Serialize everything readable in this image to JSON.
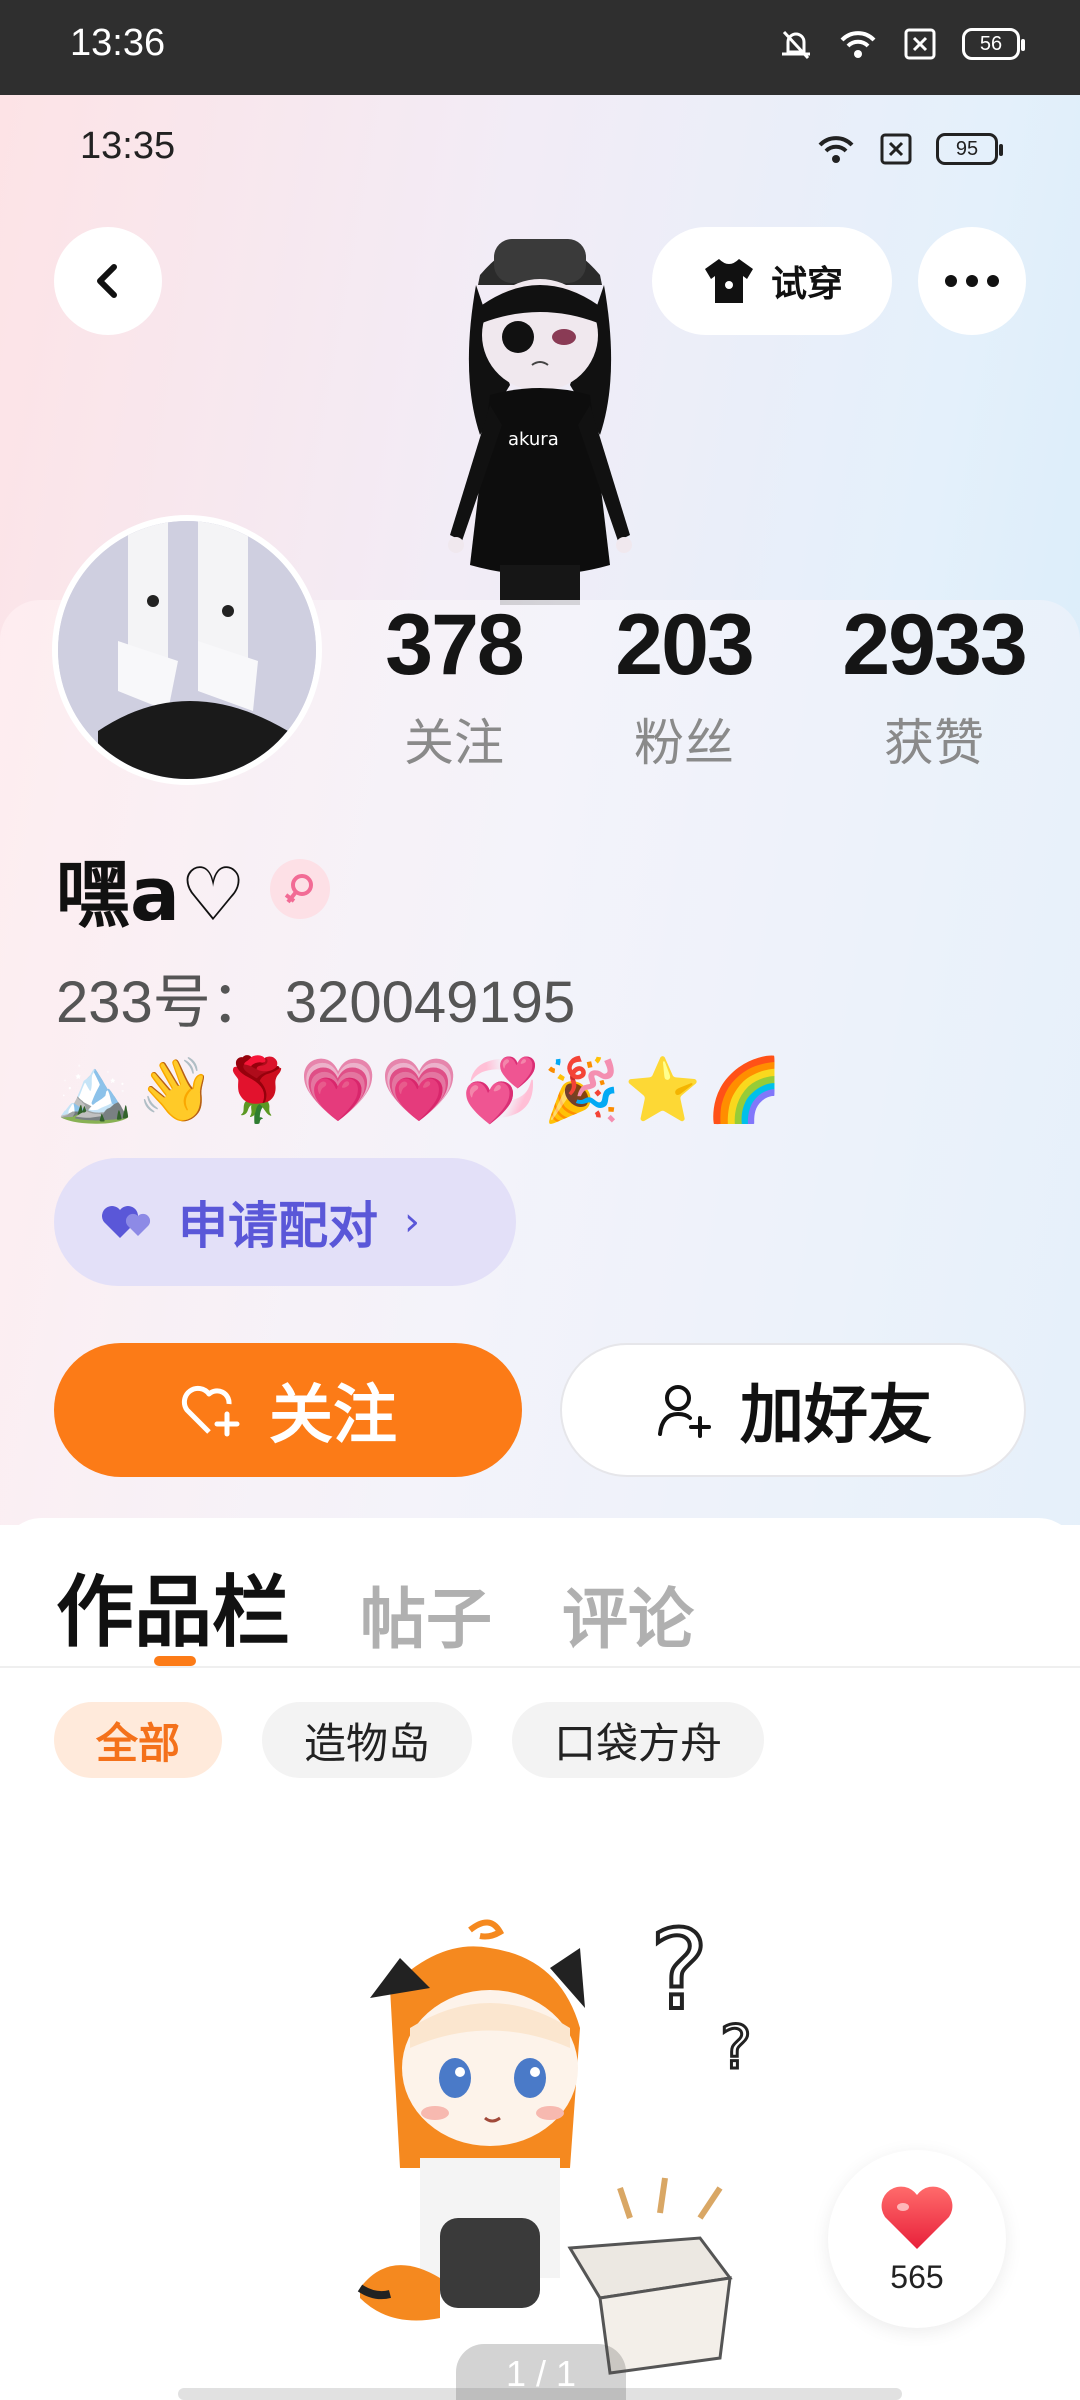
{
  "system_status": {
    "time": "13:36",
    "battery": "56",
    "icons": [
      "mute-bell-icon",
      "wifi-icon",
      "sim-x-icon",
      "battery-icon"
    ]
  },
  "inner_status": {
    "time": "13:35",
    "battery": "95",
    "icons": [
      "wifi-icon",
      "sim-x-icon",
      "battery-icon"
    ]
  },
  "header": {
    "back_icon": "chevron-left-icon",
    "tryon_label": "试穿",
    "tryon_icon": "tshirt-icon",
    "more_icon": "more-dots-icon"
  },
  "profile": {
    "nickname": "嘿a♡",
    "gender_icon": "female-icon",
    "uid": "233号： 320049195",
    "emojis": "🏔️👋🌹💗💗💞🎉⭐🌈",
    "stats": [
      {
        "value": "378",
        "label": "关注"
      },
      {
        "value": "203",
        "label": "粉丝"
      },
      {
        "value": "2933",
        "label": "获赞"
      }
    ],
    "pair_label": "申请配对",
    "pair_icon": "double-heart-icon",
    "follow_label": "关注",
    "follow_icon": "heart-plus-icon",
    "add_friend_label": "加好友",
    "add_friend_icon": "person-add-icon"
  },
  "tabs": [
    {
      "label": "作品栏",
      "active": true
    },
    {
      "label": "帖子",
      "active": false
    },
    {
      "label": "评论",
      "active": false
    }
  ],
  "filters": [
    {
      "label": "全部",
      "active": true
    },
    {
      "label": "造物岛",
      "active": false
    },
    {
      "label": "口袋方舟",
      "active": false
    }
  ],
  "like_fab": {
    "count": "565",
    "icon": "heart-icon"
  },
  "pager": {
    "text": "1 / 1"
  },
  "colors": {
    "accent_orange": "#fc7b17",
    "pair_purple": "#5a57d8",
    "pair_bg": "#e3e0f8"
  }
}
